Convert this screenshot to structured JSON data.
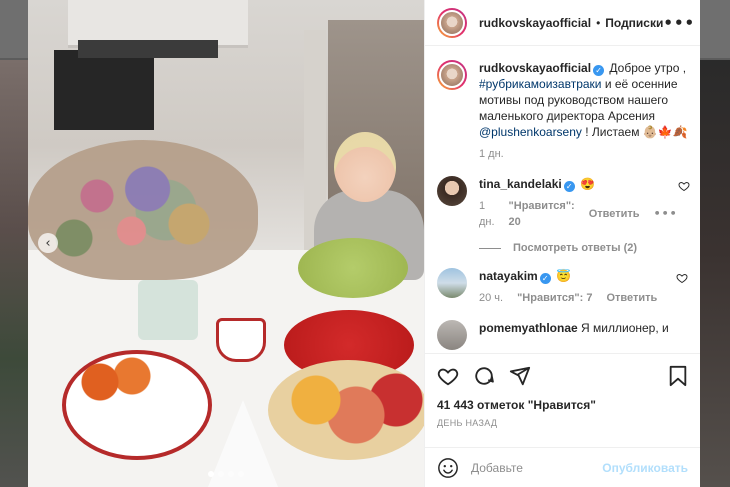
{
  "post": {
    "username": "rudkovskayaofficial",
    "separator": "•",
    "follow_label": "Подписки",
    "more_label": "•••",
    "caption": {
      "text1": " Доброе утро , ",
      "hashtag": "#рубрикамоизавтраки",
      "text2": " и её осенние мотивы под руководством нашего маленького директора Арсения ",
      "mention": "@plushenkoarseny",
      "text3": " ! Листаем 👶🏼🍁🍂",
      "time": "1 дн."
    }
  },
  "comments": [
    {
      "username": "tina_kandelaki",
      "text": " 😍",
      "time": "1 дн.",
      "likes": "\"Нравится\": 20",
      "reply_label": "Ответить",
      "more": "•••",
      "replies_label": "Посмотреть ответы (2)"
    },
    {
      "username": "natayakim",
      "text": " 😇",
      "time": "20 ч.",
      "likes": "\"Нравится\": 7",
      "reply_label": "Ответить"
    },
    {
      "username": "pomemyathlonae",
      "text": " Я миллионер, и"
    }
  ],
  "actions": {
    "likes_count": "41 443 отметок \"Нравится\"",
    "time_ago": "ДЕНЬ НАЗАД"
  },
  "add_comment": {
    "placeholder": "Добавьте",
    "post_label": "Опубликовать"
  },
  "photo": {
    "prev_arrow": "‹",
    "slide_count": 4,
    "active_slide": 1
  },
  "colors": {
    "verified": "#3897f0",
    "link": "#00376b",
    "muted": "#8e8e8e",
    "post_button_disabled": "#b2dffc"
  }
}
